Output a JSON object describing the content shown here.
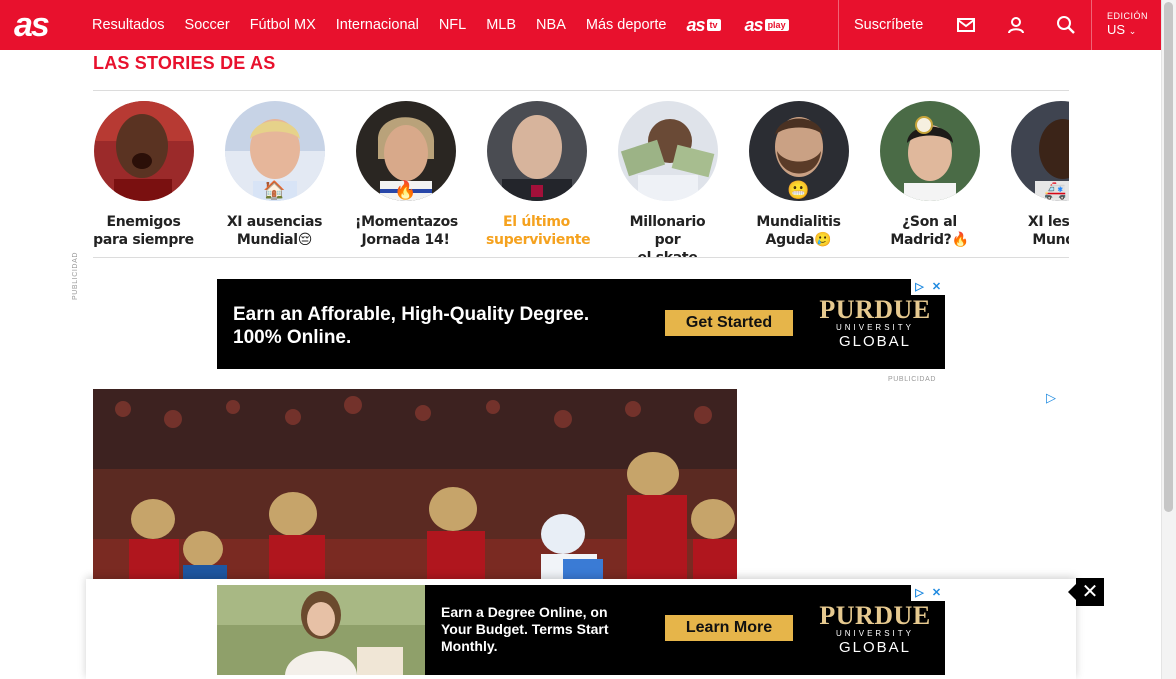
{
  "header": {
    "logo_text": "as",
    "nav_items": [
      "Resultados",
      "Soccer",
      "Fútbol MX",
      "Internacional",
      "NFL",
      "MLB",
      "NBA",
      "Más deporte"
    ],
    "brand_tv": "as",
    "brand_tv_sub": "tv",
    "brand_play": "as",
    "brand_play_sub": "play",
    "subscribe_label": "Suscríbete",
    "edition_label": "EDICIÓN",
    "edition_value": "US"
  },
  "stories": {
    "title": "LAS STORIES DE AS",
    "items": [
      {
        "line1": "Enemigos",
        "line2": "para siempre",
        "emoji": ""
      },
      {
        "line1": "XI ausencias",
        "line2": "Mundial😔",
        "emoji": "🏠"
      },
      {
        "line1": "¡Momentazos",
        "line2": "Jornada 14!",
        "emoji": "🔥"
      },
      {
        "line1": "El último",
        "line2": "superviviente",
        "emoji": "⚽"
      },
      {
        "line1": "Millonario por",
        "line2": "el skate",
        "emoji": ""
      },
      {
        "line1": "Mundialitis",
        "line2": "Aguda🥲",
        "emoji": "😬"
      },
      {
        "line1": "¿Son al",
        "line2": "Madrid?🔥",
        "emoji": ""
      },
      {
        "line1": "XI lesion",
        "line2": "Mundia",
        "emoji": "🚑"
      }
    ]
  },
  "ads": {
    "publicidad_label": "PUBLICIDAD",
    "top": {
      "headline_line1": "Earn an Afforable, High-Quality Degree.",
      "headline_line2": "100% Online.",
      "cta": "Get Started",
      "logo_line1": "PURDUE",
      "logo_line2": "UNIVERSITY",
      "logo_line3": "GLOBAL"
    },
    "bottom": {
      "headline_line1": "Earn a Degree Online, on",
      "headline_line2": "Your Budget. Terms Start",
      "headline_line3": "Monthly.",
      "cta": "Learn More",
      "logo_line1": "PURDUE",
      "logo_line2": "UNIVERSITY",
      "logo_line3": "GLOBAL"
    },
    "close_symbol": "✕"
  },
  "colors": {
    "brand_red": "#e8112d",
    "active_story": "#f5a21f",
    "cta_gold": "#e6b54a"
  }
}
